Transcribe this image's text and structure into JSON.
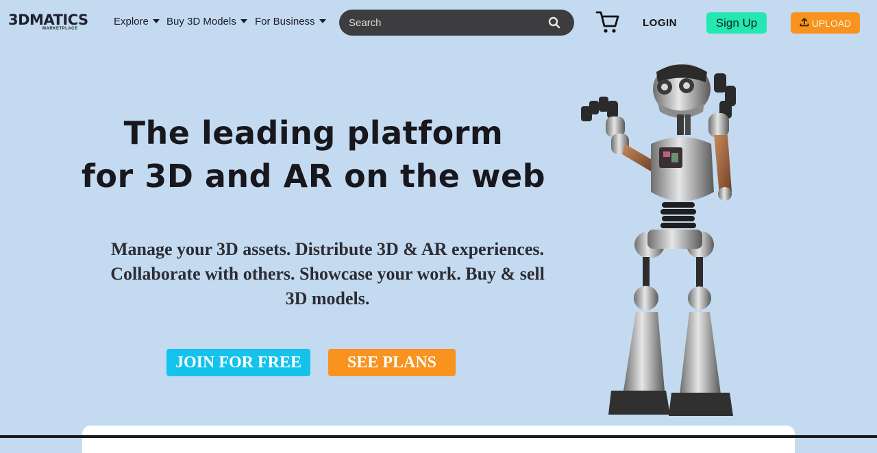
{
  "logo": {
    "text": "3DMATICS",
    "sub": "MARKETPLACE"
  },
  "nav": {
    "items": [
      {
        "label": "Explore"
      },
      {
        "label": "Buy 3D Models"
      },
      {
        "label": "For Business"
      }
    ]
  },
  "search": {
    "placeholder": "Search",
    "icon": "search-icon"
  },
  "header": {
    "cart_icon": "cart-icon",
    "login_label": "LOGIN",
    "signup_label": "Sign Up",
    "upload_label": "UPLOAD",
    "upload_icon": "upload-icon"
  },
  "hero": {
    "title_line1": "The leading platform",
    "title_line2": "for 3D and AR on the web",
    "subtitle_line1": "Manage your 3D assets. Distribute 3D & AR experiences.",
    "subtitle_line2": "Collaborate with others. Showcase your work. Buy & sell",
    "subtitle_line3": "3D models.",
    "join_label": "JOIN FOR FREE",
    "plans_label": "SEE PLANS",
    "image": "robot-3d-model"
  },
  "colors": {
    "background": "#c4daf0",
    "search_bg": "#3d3d3f",
    "signup": "#23e8b2",
    "upload": "#f7931e",
    "join": "#15c2ec",
    "plans": "#f7931e"
  }
}
